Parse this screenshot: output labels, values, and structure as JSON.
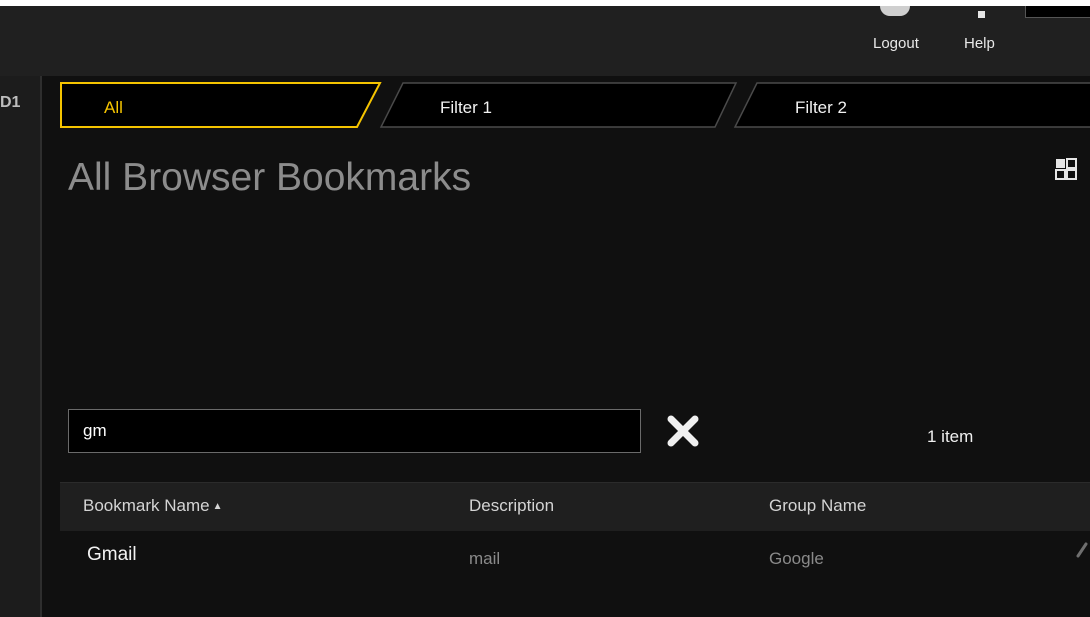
{
  "header": {
    "logout_label": "Logout",
    "help_label": "Help"
  },
  "rail": {
    "label": "D1"
  },
  "tabs": [
    {
      "label": "All",
      "active": true
    },
    {
      "label": "Filter 1",
      "active": false
    },
    {
      "label": "Filter 2",
      "active": false
    }
  ],
  "page": {
    "title": "All Browser Bookmarks"
  },
  "search": {
    "value": "gm",
    "placeholder": ""
  },
  "results": {
    "count_text": "1 item"
  },
  "table": {
    "columns": [
      {
        "label": "Bookmark Name",
        "sorted": "ascending"
      },
      {
        "label": "Description"
      },
      {
        "label": "Group Name"
      }
    ],
    "rows": [
      {
        "name": "Gmail",
        "description": "mail",
        "group": "Google"
      }
    ]
  },
  "colors": {
    "accent": "#f5c400",
    "background": "#101010",
    "header": "#202020",
    "muted_text": "#8c8c8c"
  },
  "icons": {
    "clear": "close-x-icon",
    "view": "grid-view-icon",
    "sort": "sort-ascending-icon"
  }
}
